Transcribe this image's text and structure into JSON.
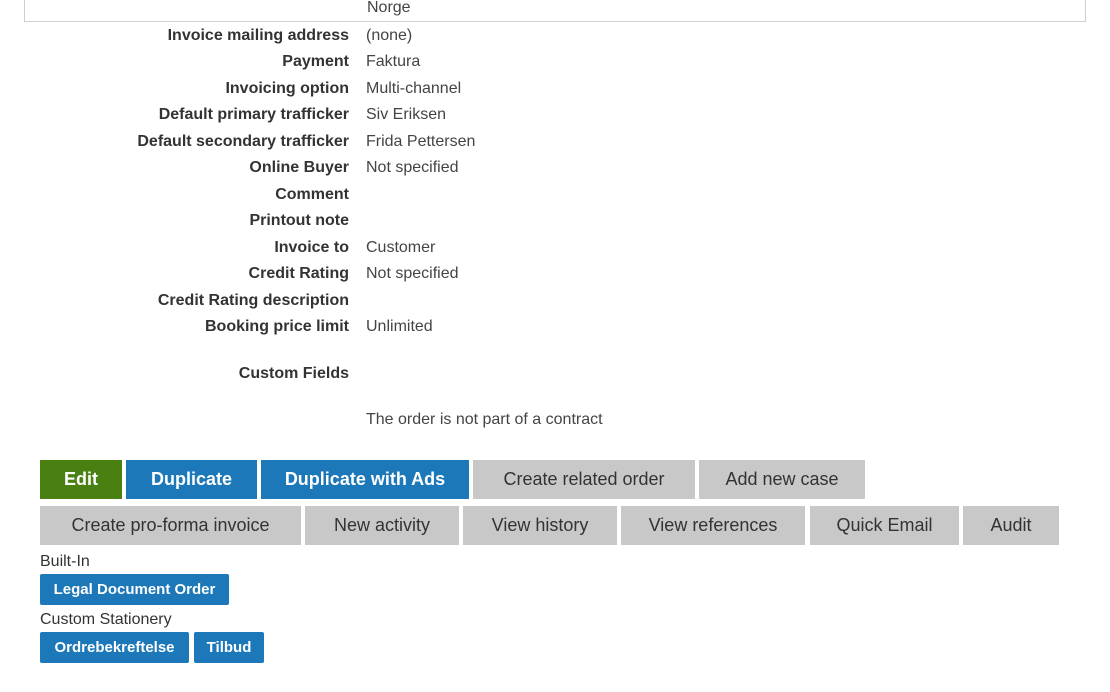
{
  "top_value": "Norge",
  "details": [
    {
      "label": "Invoice mailing address",
      "value": "(none)"
    },
    {
      "label": "Payment",
      "value": "Faktura"
    },
    {
      "label": "Invoicing option",
      "value": "Multi-channel"
    },
    {
      "label": "Default primary trafficker",
      "value": "Siv Eriksen"
    },
    {
      "label": "Default secondary trafficker",
      "value": "Frida Pettersen"
    },
    {
      "label": "Online Buyer",
      "value": "Not specified"
    },
    {
      "label": "Comment",
      "value": ""
    },
    {
      "label": "Printout note",
      "value": ""
    },
    {
      "label": "Invoice to",
      "value": "Customer"
    },
    {
      "label": "Credit Rating",
      "value": "Not specified"
    },
    {
      "label": "Credit Rating description",
      "value": ""
    },
    {
      "label": "Booking price limit",
      "value": "Unlimited"
    }
  ],
  "custom_fields_label": "Custom Fields",
  "contract_note": "The order is not part of a contract",
  "buttons": {
    "edit": "Edit",
    "duplicate": "Duplicate",
    "duplicate_with_ads": "Duplicate with Ads",
    "create_related_order": "Create related order",
    "add_new_case": "Add new case",
    "create_pro_forma_invoice": "Create pro-forma invoice",
    "new_activity": "New activity",
    "view_history": "View history",
    "view_references": "View references",
    "quick_email": "Quick Email",
    "audit": "Audit"
  },
  "built_in": {
    "label": "Built-In",
    "items": [
      "Legal Document Order"
    ]
  },
  "custom_stationery": {
    "label": "Custom Stationery",
    "items": [
      "Ordrebekreftelse",
      "Tilbud"
    ]
  },
  "colors": {
    "edit_button": "#4a7f12",
    "primary_button": "#1c78b8",
    "secondary_button": "#c8c8c8"
  }
}
